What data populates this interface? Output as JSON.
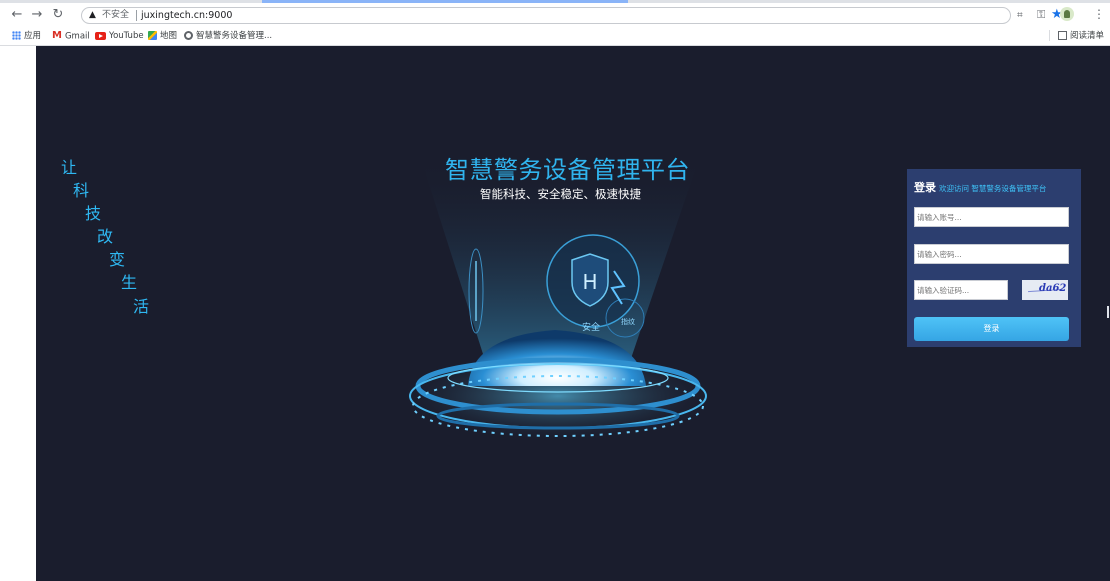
{
  "browser": {
    "security_label": "不安全",
    "url": "juxingtech.cn:9000",
    "bookmarks": [
      {
        "label": "应用"
      },
      {
        "label": "Gmail"
      },
      {
        "label": "YouTube"
      },
      {
        "label": "地图"
      },
      {
        "label": "智慧警务设备管理..."
      }
    ],
    "reading_list": "阅读清单"
  },
  "page": {
    "slogan": [
      "让",
      "科",
      "技",
      "改",
      "变",
      "生",
      "活"
    ],
    "title": "智慧警务设备管理平台",
    "subtitle": "智能科技、安全稳定、极速快捷",
    "illustration": {
      "shield_letter": "H",
      "shield_caption": "安全",
      "bubble_caption": "指纹"
    },
    "login": {
      "title": "登录",
      "welcome": "欢迎访问 智慧警务设备管理平台",
      "account_placeholder": "请输入账号...",
      "password_placeholder": "请输入密码...",
      "captcha_placeholder": "请输入验证码...",
      "captcha_text": "da62",
      "submit_label": "登录"
    }
  },
  "colors": {
    "page_bg": "#1a1d2d",
    "accent": "#30b4ee",
    "card_bg": "#2c3e6f",
    "button": "#4fc3f7"
  }
}
